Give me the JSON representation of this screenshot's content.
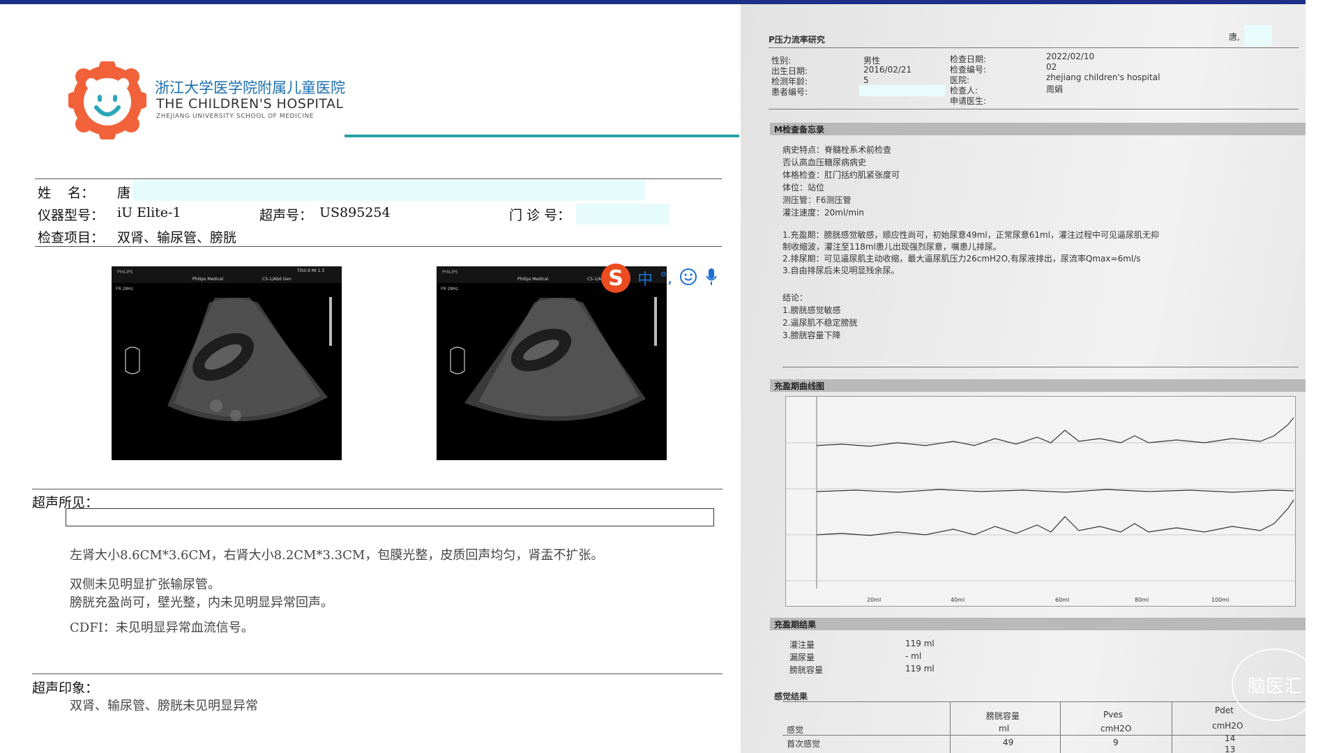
{
  "report": {
    "hospital_cn": "浙江大学医学院附属儿童医院",
    "hospital_en": "THE CHILDREN'S HOSPITAL",
    "hospital_sub": "ZHEJIANG UNIVERSITY SCHOOL OF MEDICINE",
    "name_label": "姓    名：",
    "name_value": "唐",
    "device_label": "仪器型号：",
    "device_value": "iU Elite-1",
    "us_no_label": "超声号：",
    "us_no_value": "US895254",
    "clinic_label": "门 诊 号：",
    "exam_label": "检查项目：",
    "exam_value": "双肾、输尿管、膀胱",
    "findings_label": "超声所见：",
    "findings": [
      "左肾大小8.6CM*3.6CM，右肾大小8.2CM*3.3CM，包膜光整，皮质回声均匀，肾盂不扩张。",
      "双侧未见明显扩张输尿管。",
      "膀胱充盈尚可，壁光整，内未见明显异常回声。",
      "CDFI：未见明显异常血流信号。"
    ],
    "impression_label": "超声印象：",
    "impression": "双肾、输尿管、膀胱未见明显异常"
  },
  "ultrasound_images": [
    {
      "brand": "PHILIPS",
      "system": "Philips Medical",
      "probe": "C5-1/Abd Gen",
      "tis": "TIS0.9  MI 1.3",
      "rate": "FR 28Hz"
    },
    {
      "brand": "PHILIPS",
      "system": "Philips Medical",
      "probe": "C5-1/A",
      "tis": "",
      "rate": "FR 28Hz"
    }
  ],
  "ime_toolbar": {
    "logo": "S",
    "mode": "中",
    "punct": "°,",
    "emoji_icon": "smiley-icon",
    "mic_icon": "microphone-icon"
  },
  "pressure_report": {
    "title": "P压力流率研究",
    "corner": "唐,",
    "labels_left": [
      "性别:",
      "出生日期:",
      "检测年龄:",
      "患者编号:"
    ],
    "values_left": [
      "男性",
      "2016/02/21",
      "5",
      ""
    ],
    "labels_right": [
      "检查日期:",
      "检查编号:",
      "医院:",
      "检查人:",
      "申请医生:"
    ],
    "values_right": [
      "2022/02/10",
      "02",
      "zhejiang children's hospital",
      "周娟",
      ""
    ],
    "record_title": "M检查备忘录",
    "record_lines": [
      "病史特点：脊髓栓系术前检查",
      "否认高血压糖尿病病史",
      "体格检查：肛门括约肌紧张度可",
      "体位：站位",
      "测压管：F6测压管",
      "灌注速度：20ml/min"
    ],
    "record_items": [
      "1.充盈期：膀胱感觉敏感，顺应性尚可，初始尿意49ml，正常尿意61ml，灌注过程中可见逼尿肌无抑",
      "制收缩波，灌注至118ml患儿出现强烈尿意，嘱患儿排尿。",
      "2.排尿期：可见逼尿肌主动收缩，最大逼尿肌压力26cmH2O,有尿液排出，尿流率Qmax=6ml/s",
      "3.自由排尿后未见明显残余尿。"
    ],
    "conclusion_title": "结论：",
    "conclusions": [
      "1.膀胱感觉敏感",
      "2.逼尿肌不稳定膀胱",
      "3.膀胱容量下降"
    ],
    "curve_title": "充盈期曲线图",
    "curve_axis_labels": [
      "20ml",
      "40ml",
      "60ml",
      "80ml",
      "100ml"
    ],
    "result_title": "充盈期结果",
    "result_labels": [
      "灌注量",
      "漏尿量",
      "膀胱容量"
    ],
    "result_values": [
      "119 ml",
      "- ml",
      "119 ml"
    ],
    "sense_title": "感觉结果",
    "sense_headers": [
      "膀胱容量",
      "Pves",
      "Pdet"
    ],
    "sense_units": [
      "ml",
      "cmH2O",
      "cmH2O"
    ],
    "sense_row_label": "感觉",
    "sense_rows": [
      {
        "label": "首次感觉",
        "values": [
          "49",
          "9",
          "14"
        ]
      },
      {
        "label": "",
        "values": [
          "",
          "",
          "13"
        ]
      }
    ]
  },
  "watermark": "脑医汇"
}
